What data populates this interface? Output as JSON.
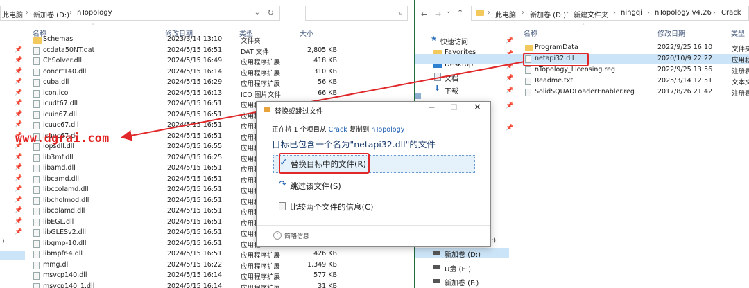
{
  "left_explorer": {
    "address": {
      "pc": "此电脑",
      "sep": "›",
      "drive": "新加卷 (D:)",
      "folder": "nTopology"
    },
    "columns": {
      "name": "名称",
      "date": "修改日期",
      "type": "类型",
      "size": "大小"
    },
    "files": [
      {
        "name": "Schemas",
        "date": "2023/3/14 13:10",
        "type": "文件夹",
        "size": ""
      },
      {
        "name": "ccdata50NT.dat",
        "date": "2024/5/15 16:51",
        "type": "DAT 文件",
        "size": "2,805 KB"
      },
      {
        "name": "ChSolver.dll",
        "date": "2024/5/15 16:49",
        "type": "应用程序扩展",
        "size": "418 KB"
      },
      {
        "name": "concrt140.dll",
        "date": "2024/5/15 16:14",
        "type": "应用程序扩展",
        "size": "310 KB"
      },
      {
        "name": "cuba.dll",
        "date": "2024/5/15 16:29",
        "type": "应用程序扩展",
        "size": "56 KB"
      },
      {
        "name": "icon.ico",
        "date": "2024/5/15 16:13",
        "type": "ICO 图片文件",
        "size": "66 KB"
      },
      {
        "name": "icudt67.dll",
        "date": "2024/5/15 16:51",
        "type": "应用程",
        "size": ""
      },
      {
        "name": "icuin67.dll",
        "date": "2024/5/15 16:51",
        "type": "应用程",
        "size": ""
      },
      {
        "name": "icuuc67.dll",
        "date": "2024/5/15 16:51",
        "type": "应用程",
        "size": ""
      },
      {
        "name": "icuuc67.dll",
        "date": "2024/5/15 16:51",
        "type": "应用程",
        "size": ""
      },
      {
        "name": "iopsdll.dll",
        "date": "2024/5/15 16:55",
        "type": "应用程",
        "size": ""
      },
      {
        "name": "lib3mf.dll",
        "date": "2024/5/15 16:25",
        "type": "应用程",
        "size": ""
      },
      {
        "name": "libamd.dll",
        "date": "2024/5/15 16:51",
        "type": "应用程",
        "size": ""
      },
      {
        "name": "libcamd.dll",
        "date": "2024/5/15 16:51",
        "type": "应用程",
        "size": ""
      },
      {
        "name": "libccolamd.dll",
        "date": "2024/5/15 16:51",
        "type": "应用程",
        "size": ""
      },
      {
        "name": "libcholmod.dll",
        "date": "2024/5/15 16:51",
        "type": "应用程",
        "size": ""
      },
      {
        "name": "libcolamd.dll",
        "date": "2024/5/15 16:51",
        "type": "应用程",
        "size": ""
      },
      {
        "name": "libEGL.dll",
        "date": "2024/5/15 16:51",
        "type": "应用程",
        "size": ""
      },
      {
        "name": "libGLESv2.dll",
        "date": "2024/5/15 16:51",
        "type": "应用程",
        "size": ""
      },
      {
        "name": "libgmp-10.dll",
        "date": "2024/5/15 16:51",
        "type": "应用程",
        "size": ""
      },
      {
        "name": "libmpfr-4.dll",
        "date": "2024/5/15 16:51",
        "type": "应用程序扩展",
        "size": "426 KB"
      },
      {
        "name": "mmg.dll",
        "date": "2024/5/15 16:22",
        "type": "应用程序扩展",
        "size": "1,349 KB"
      },
      {
        "name": "msvcp140.dll",
        "date": "2024/5/15 16:14",
        "type": "应用程序扩展",
        "size": "577 KB"
      },
      {
        "name": "msvcp140_1.dll",
        "date": "2024/5/15 16:14",
        "type": "应用程序扩展",
        "size": "31 KB"
      }
    ],
    "status_fragment": ":)"
  },
  "right_explorer": {
    "address": {
      "pc": "此电脑",
      "drive": "新加卷 (D:)",
      "folder1": "新建文件夹",
      "folder2": "ningqi",
      "folder3": "nTopology v4.26",
      "folder4": "Crack"
    },
    "columns": {
      "name": "名称",
      "date": "修改日期",
      "type": "类型"
    },
    "nav": {
      "quick_access": "快速访问",
      "favorites": "Favorites",
      "desktop": "Desktop",
      "documents": "文档",
      "downloads": "下载",
      "drive_d": "新加卷 (D:)",
      "drive_e": "U盘 (E:)",
      "drive_f": "新加卷 (F:)",
      "drive_fragment": "(:)"
    },
    "files": [
      {
        "name": "ProgramData",
        "date": "2022/9/25 16:10",
        "type": "文件夹"
      },
      {
        "name": "netapi32.dll",
        "date": "2020/10/9 22:22",
        "type": "应用程"
      },
      {
        "name": "nTopology_Licensing.reg",
        "date": "2022/9/25 13:56",
        "type": "注册表"
      },
      {
        "name": "Readme.txt",
        "date": "2025/3/14 12:51",
        "type": "文本文"
      },
      {
        "name": "SolidSQUADLoaderEnabler.reg",
        "date": "2017/8/26 21:42",
        "type": "注册表"
      }
    ]
  },
  "dialog": {
    "title": "替换或跳过文件",
    "copy_status": {
      "prefix": "正在将 1 个项目从 ",
      "src": "Crack",
      "mid": " 复制到 ",
      "dst": "nTopology"
    },
    "heading": "目标已包含一个名为\"netapi32.dll\"的文件",
    "opt_replace": "替换目标中的文件(R)",
    "opt_skip": "跳过该文件(S)",
    "opt_compare": "比较两个文件的信息(C)",
    "details": "简略信息"
  },
  "watermark": "www.dgrai.com",
  "colors": {
    "highlight": "#e0282b",
    "selected": "#cce4f7",
    "link": "#1f5fb4"
  }
}
